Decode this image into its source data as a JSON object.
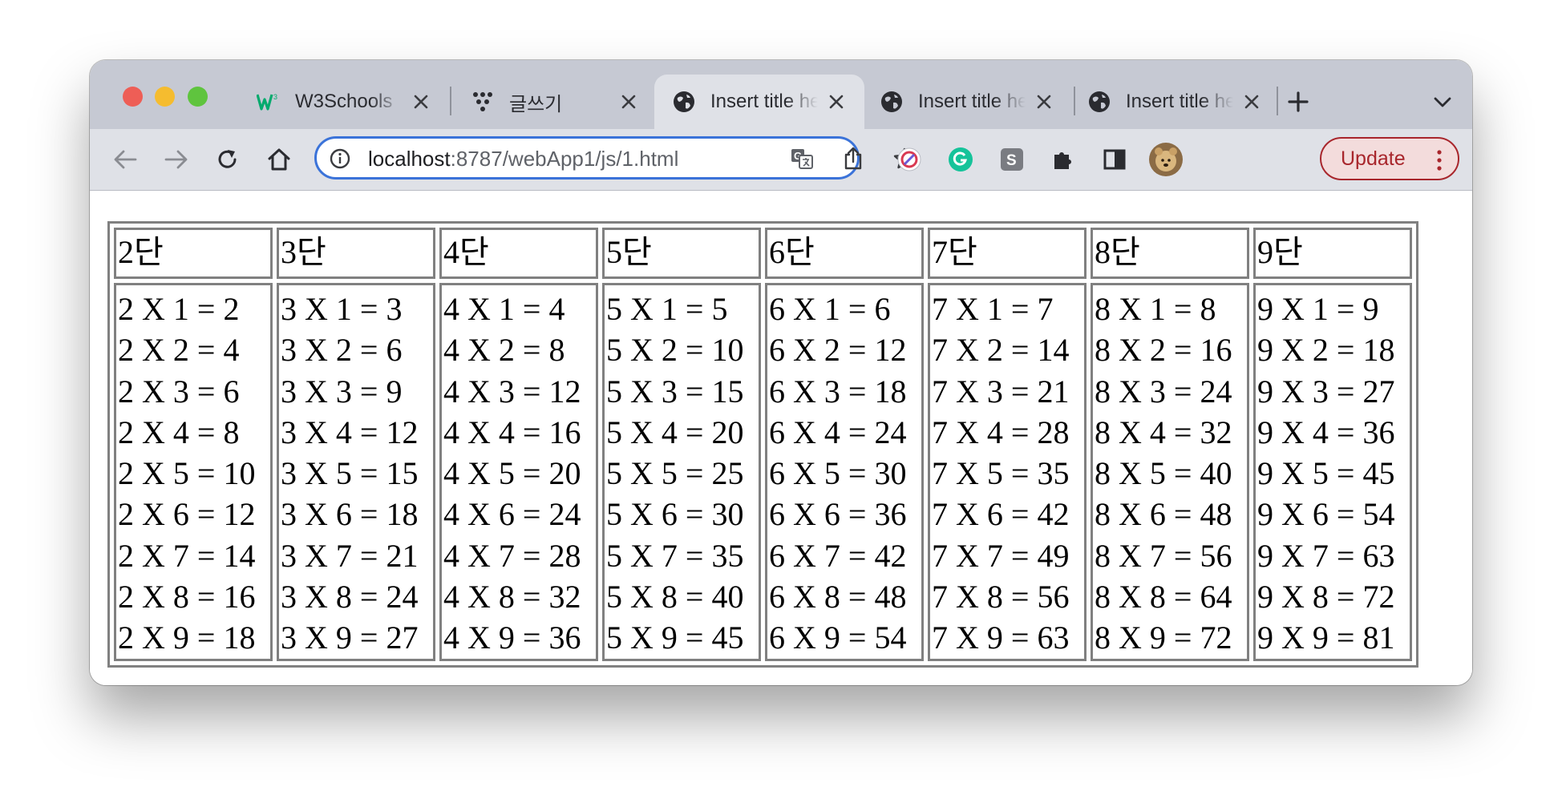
{
  "tabs": [
    {
      "title": "W3Schools",
      "icon": "w3schools-logo-icon",
      "active": false
    },
    {
      "title": "글쓰기",
      "icon": "dots-logo-icon",
      "active": false
    },
    {
      "title": "Insert title here",
      "icon": "globe-icon",
      "active": true
    },
    {
      "title": "Insert title here",
      "icon": "globe-icon",
      "active": false
    },
    {
      "title": "Insert title here",
      "icon": "globe-icon",
      "active": false
    }
  ],
  "address_bar": {
    "host": "localhost",
    "path": ":8787/webApp1/js/1.html"
  },
  "update_button": {
    "label": "Update"
  },
  "colors": {
    "accent": "#3b73d9",
    "update": "#a8262c"
  },
  "table": {
    "headers": [
      "2단",
      "3단",
      "4단",
      "5단",
      "6단",
      "7단",
      "8단",
      "9단"
    ],
    "columns": [
      [
        "2 X 1 = 2",
        "2 X 2 = 4",
        "2 X 3 = 6",
        "2 X 4 = 8",
        "2 X 5 = 10",
        "2 X 6 = 12",
        "2 X 7 = 14",
        "2 X 8 = 16",
        "2 X 9 = 18"
      ],
      [
        "3 X 1 = 3",
        "3 X 2 = 6",
        "3 X 3 = 9",
        "3 X 4 = 12",
        "3 X 5 = 15",
        "3 X 6 = 18",
        "3 X 7 = 21",
        "3 X 8 = 24",
        "3 X 9 = 27"
      ],
      [
        "4 X 1 = 4",
        "4 X 2 = 8",
        "4 X 3 = 12",
        "4 X 4 = 16",
        "4 X 5 = 20",
        "4 X 6 = 24",
        "4 X 7 = 28",
        "4 X 8 = 32",
        "4 X 9 = 36"
      ],
      [
        "5 X 1 = 5",
        "5 X 2 = 10",
        "5 X 3 = 15",
        "5 X 4 = 20",
        "5 X 5 = 25",
        "5 X 6 = 30",
        "5 X 7 = 35",
        "5 X 8 = 40",
        "5 X 9 = 45"
      ],
      [
        "6 X 1 = 6",
        "6 X 2 = 12",
        "6 X 3 = 18",
        "6 X 4 = 24",
        "6 X 5 = 30",
        "6 X 6 = 36",
        "6 X 7 = 42",
        "6 X 8 = 48",
        "6 X 9 = 54"
      ],
      [
        "7 X 1 = 7",
        "7 X 2 = 14",
        "7 X 3 = 21",
        "7 X 4 = 28",
        "7 X 5 = 35",
        "7 X 6 = 42",
        "7 X 7 = 49",
        "7 X 8 = 56",
        "7 X 9 = 63"
      ],
      [
        "8 X 1 = 8",
        "8 X 2 = 16",
        "8 X 3 = 24",
        "8 X 4 = 32",
        "8 X 5 = 40",
        "8 X 6 = 48",
        "8 X 7 = 56",
        "8 X 8 = 64",
        "8 X 9 = 72"
      ],
      [
        "9 X 1 = 9",
        "9 X 2 = 18",
        "9 X 3 = 27",
        "9 X 4 = 36",
        "9 X 5 = 45",
        "9 X 6 = 54",
        "9 X 7 = 63",
        "9 X 8 = 72",
        "9 X 9 = 81"
      ]
    ]
  }
}
